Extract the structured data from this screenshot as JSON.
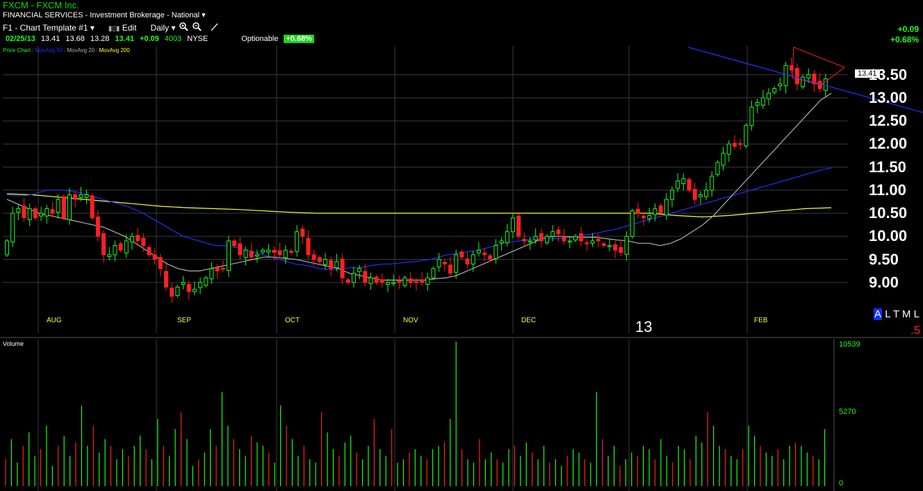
{
  "header": {
    "title": "FXCM  -  FXCM Inc.",
    "sector": "FINANCIAL SERVICES - Investment Brokerage - National",
    "template": "F1 - Chart Template #1",
    "edit_label": "Edit",
    "period_label": "Daily",
    "date": "02/25/13",
    "open": "13.41",
    "high": "13.68",
    "low": "13.28",
    "close": "13.41",
    "change": "+0.09",
    "volume": "4003",
    "exchange": "NYSE",
    "optionable": "Optionable",
    "pct_badge": "+0.68%",
    "right_change": "+0.09",
    "right_pct": "+0.68%"
  },
  "legend": {
    "price": "Price Chart",
    "ma50": "MovAvg 50",
    "ma20": "MovAvg 20",
    "ma200": "MovAvg 200"
  },
  "colors": {
    "up": "#19ff19",
    "down": "#ff2020",
    "ma50": "#2030ff",
    "ma20": "#b0b0b0",
    "ma200": "#ffff30",
    "grid": "#3a3a3a",
    "month": "#ffff30"
  },
  "price_axis": {
    "labels": [
      "13.50",
      "13.00",
      "12.50",
      "12.00",
      "11.50",
      "11.00",
      "10.50",
      "10.00",
      "9.50",
      "9.00"
    ],
    "current_label": "13.41"
  },
  "months": [
    "AUG",
    "SEP",
    "OCT",
    "NOV",
    "DEC",
    "FEB"
  ],
  "year_label": "13",
  "corner": {
    "a": "A",
    "ltml": "L T M L",
    "five": ".5"
  },
  "volume_panel": {
    "label": "Volume",
    "max": "10539",
    "mid": "5270",
    "zero": "0"
  },
  "chart_data": {
    "type": "candlestick",
    "ylim": [
      8.5,
      13.9
    ],
    "closes": [
      9.9,
      10.5,
      10.6,
      10.4,
      10.6,
      10.4,
      10.5,
      10.6,
      10.5,
      10.8,
      10.4,
      10.9,
      10.8,
      10.9,
      10.9,
      10.4,
      10.0,
      9.6,
      9.6,
      9.8,
      9.7,
      9.9,
      10.0,
      9.9,
      9.8,
      9.6,
      9.5,
      9.3,
      8.9,
      8.7,
      8.9,
      9.0,
      8.8,
      8.85,
      9.0,
      9.1,
      9.3,
      9.25,
      9.3,
      9.9,
      9.8,
      9.6,
      9.7,
      9.55,
      9.6,
      9.7,
      9.7,
      9.65,
      9.6,
      9.7,
      9.65,
      10.1,
      10.0,
      9.6,
      9.5,
      9.45,
      9.5,
      9.3,
      9.45,
      9.1,
      9.0,
      9.2,
      9.3,
      9.0,
      9.1,
      9.0,
      9.0,
      9.0,
      9.0,
      9.0,
      9.1,
      9.0,
      9.0,
      9.0,
      9.1,
      9.3,
      9.5,
      9.4,
      9.2,
      9.6,
      9.55,
      9.4,
      9.6,
      9.7,
      9.6,
      9.5,
      9.8,
      9.9,
      10.1,
      10.4,
      10.0,
      9.9,
      9.9,
      10.0,
      9.9,
      10.0,
      10.1,
      10.05,
      9.9,
      9.9,
      10.0,
      9.9,
      9.85,
      9.9,
      9.9,
      9.8,
      9.8,
      9.7,
      9.65,
      10.0,
      10.55,
      10.5,
      10.4,
      10.45,
      10.6,
      10.5,
      10.8,
      11.0,
      11.2,
      11.25,
      11.0,
      10.8,
      10.9,
      11.0,
      11.3,
      11.6,
      11.8,
      12.0,
      11.95,
      12.0,
      12.4,
      12.8,
      12.9,
      13.0,
      13.1,
      13.2,
      13.3,
      13.7,
      13.6,
      13.3,
      13.45,
      13.5,
      13.3,
      13.2,
      13.41
    ],
    "ma50": [
      10.9,
      10.88,
      10.88,
      10.9,
      10.95,
      11.0,
      11.0,
      11.0,
      10.98,
      10.95,
      10.9,
      10.85,
      10.8,
      10.75,
      10.7,
      10.65,
      10.58,
      10.5,
      10.4,
      10.3,
      10.2,
      10.1,
      10.0,
      9.95,
      9.9,
      9.85,
      9.8,
      9.8,
      9.78,
      9.75,
      9.7,
      9.65,
      9.6,
      9.55,
      9.5,
      9.45,
      9.4,
      9.38,
      9.35,
      9.3,
      9.28,
      9.28,
      9.3,
      9.32,
      9.32,
      9.35,
      9.38,
      9.4,
      9.4,
      9.42,
      9.44,
      9.45,
      9.48,
      9.5,
      9.55,
      9.6,
      9.62,
      9.65,
      9.68,
      9.7,
      9.75,
      9.8,
      9.85,
      9.88,
      9.9,
      9.92,
      9.95,
      9.95,
      9.95,
      9.95,
      9.98,
      10.0,
      10.02,
      10.05,
      10.08,
      10.12,
      10.15,
      10.2,
      10.25,
      10.3,
      10.35,
      10.4,
      10.45,
      10.5,
      10.55,
      10.6,
      10.65,
      10.7,
      10.75,
      10.8,
      10.85,
      10.9,
      10.95,
      11.0,
      11.05,
      11.1,
      11.15,
      11.2,
      11.25,
      11.3,
      11.35,
      11.4,
      11.45,
      11.48
    ],
    "ma50_start_pct": 0.0,
    "ma20": [
      10.8,
      10.7,
      10.6,
      10.5,
      10.45,
      10.4,
      10.35,
      10.3,
      10.25,
      10.2,
      10.1,
      10.0,
      9.85,
      9.7,
      9.55,
      9.4,
      9.3,
      9.25,
      9.25,
      9.3,
      9.35,
      9.4,
      9.45,
      9.5,
      9.55,
      9.55,
      9.52,
      9.5,
      9.45,
      9.4,
      9.35,
      9.3,
      9.2,
      9.15,
      9.1,
      9.05,
      9.05,
      9.05,
      9.05,
      9.05,
      9.08,
      9.1,
      9.15,
      9.25,
      9.35,
      9.45,
      9.55,
      9.65,
      9.75,
      9.85,
      9.95,
      10.0,
      10.0,
      9.98,
      9.98,
      9.98,
      9.95,
      9.92,
      9.9,
      9.85,
      9.85,
      9.8,
      9.85,
      9.95,
      10.1,
      10.25,
      10.45,
      10.7,
      10.95,
      11.2,
      11.45,
      11.7,
      11.95,
      12.2,
      12.45,
      12.7,
      12.95,
      13.1
    ],
    "ma200": [
      10.92,
      10.9,
      10.85,
      10.8,
      10.75,
      10.7,
      10.65,
      10.62,
      10.6,
      10.58,
      10.55,
      10.52,
      10.5,
      10.5,
      10.5,
      10.5,
      10.5,
      10.5,
      10.5,
      10.5,
      10.5,
      10.5,
      10.5,
      10.5,
      10.5,
      10.5,
      10.45,
      10.42,
      10.45,
      10.5,
      10.55,
      10.6,
      10.62
    ],
    "trend_upper": [
      [
        990,
        68
      ],
      [
        1328,
        162
      ]
    ],
    "trend_lower": [
      [
        1142,
        68
      ],
      [
        1215,
        97
      ],
      [
        1180,
        122
      ],
      [
        1140,
        112
      ]
    ],
    "volume": [
      40,
      70,
      35,
      60,
      80,
      45,
      55,
      90,
      30,
      60,
      75,
      45,
      65,
      120,
      60,
      90,
      50,
      70,
      60,
      40,
      55,
      45,
      60,
      75,
      55,
      40,
      100,
      60,
      45,
      85,
      110,
      70,
      30,
      40,
      50,
      85,
      60,
      140,
      90,
      70,
      55,
      45,
      75,
      65,
      60,
      50,
      35,
      120,
      90,
      70,
      45,
      60,
      40,
      35,
      110,
      80,
      55,
      45,
      65,
      75,
      50,
      40,
      60,
      100,
      55,
      45,
      85,
      35,
      40,
      50,
      55,
      45,
      40,
      55,
      60,
      65,
      100,
      215,
      55,
      40,
      35,
      70,
      40,
      50,
      40,
      35,
      55,
      60,
      45,
      65,
      50,
      40,
      60,
      35,
      40,
      30,
      45,
      55,
      50,
      40,
      35,
      140,
      70,
      45,
      60,
      30,
      40,
      50,
      45,
      60,
      55,
      40,
      70,
      45,
      35,
      60,
      55,
      40,
      75,
      65,
      110,
      90,
      60,
      55,
      45,
      40,
      55,
      90,
      75,
      60,
      50,
      45,
      55,
      40,
      60,
      65,
      60,
      50,
      45,
      40,
      85
    ]
  }
}
